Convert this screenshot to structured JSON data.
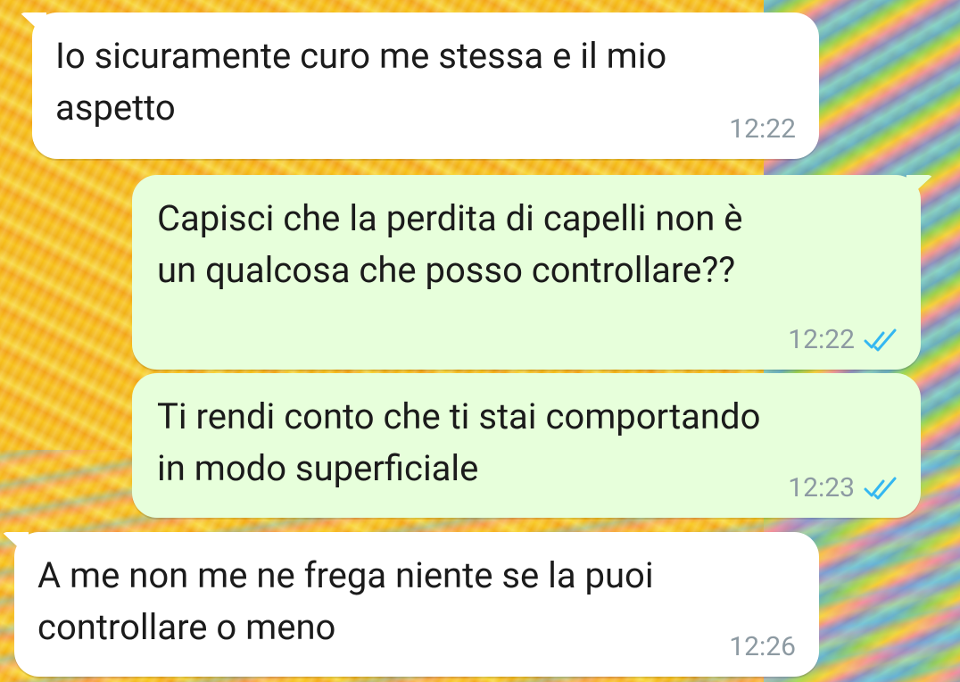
{
  "chat": {
    "messages": [
      {
        "direction": "incoming",
        "text": "Io sicuramente curo me stessa e il mio\naspetto",
        "time": "12:22"
      },
      {
        "direction": "outgoing",
        "text": "Capisci che la perdita di capelli non è\nun qualcosa che posso controllare??",
        "time": "12:22",
        "status_icon": "double-check-icon"
      },
      {
        "direction": "outgoing",
        "text": "Ti rendi conto che ti stai comportando\nin modo superficiale",
        "time": "12:23",
        "status_icon": "double-check-icon"
      },
      {
        "direction": "incoming",
        "text": "A me non me ne frega niente se la puoi\ncontrollare o meno",
        "time": "12:26"
      }
    ]
  },
  "colors": {
    "incoming_bubble": "#ffffff",
    "outgoing_bubble": "#e7ffdb",
    "timestamp": "#8d9aa2",
    "read_ticks": "#34b7f1"
  }
}
